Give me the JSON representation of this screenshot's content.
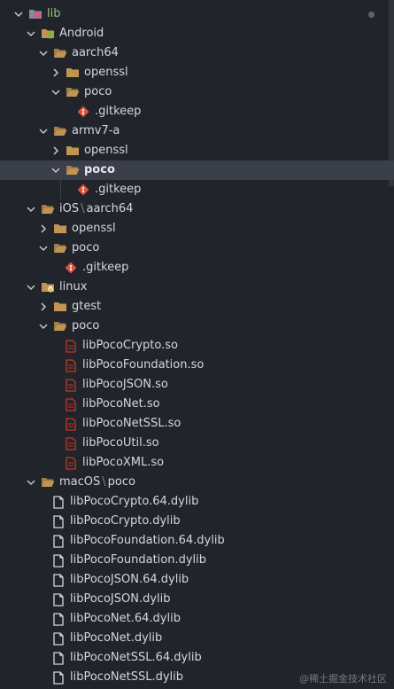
{
  "tree": [
    {
      "label": "lib",
      "type": "folder-special",
      "depth": 0,
      "expanded": true,
      "color": "#98c379",
      "dot": true
    },
    {
      "label": "Android",
      "type": "folder-android",
      "depth": 1,
      "expanded": true
    },
    {
      "label": "aarch64",
      "type": "folder",
      "depth": 2,
      "expanded": true
    },
    {
      "label": "openssl",
      "type": "folder",
      "depth": 3,
      "expanded": false
    },
    {
      "label": "poco",
      "type": "folder",
      "depth": 3,
      "expanded": true
    },
    {
      "label": ".gitkeep",
      "type": "git",
      "depth": 4
    },
    {
      "label": "armv7-a",
      "type": "folder",
      "depth": 2,
      "expanded": true
    },
    {
      "label": "openssl",
      "type": "folder",
      "depth": 3,
      "expanded": false
    },
    {
      "label": "poco",
      "type": "folder",
      "depth": 3,
      "expanded": true,
      "selected": true
    },
    {
      "label": ".gitkeep",
      "type": "git",
      "depth": 4
    },
    {
      "label": "iOS",
      "label2": "aarch64",
      "type": "folder",
      "depth": 1,
      "expanded": true
    },
    {
      "label": "openssl",
      "type": "folder",
      "depth": 2,
      "expanded": false
    },
    {
      "label": "poco",
      "type": "folder",
      "depth": 2,
      "expanded": true
    },
    {
      "label": ".gitkeep",
      "type": "git",
      "depth": 3
    },
    {
      "label": "linux",
      "type": "folder-linux",
      "depth": 1,
      "expanded": true
    },
    {
      "label": "gtest",
      "type": "folder",
      "depth": 2,
      "expanded": false
    },
    {
      "label": "poco",
      "type": "folder",
      "depth": 2,
      "expanded": true
    },
    {
      "label": "libPocoCrypto.so",
      "type": "so",
      "depth": 3
    },
    {
      "label": "libPocoFoundation.so",
      "type": "so",
      "depth": 3
    },
    {
      "label": "libPocoJSON.so",
      "type": "so",
      "depth": 3
    },
    {
      "label": "libPocoNet.so",
      "type": "so",
      "depth": 3
    },
    {
      "label": "libPocoNetSSL.so",
      "type": "so",
      "depth": 3
    },
    {
      "label": "libPocoUtil.so",
      "type": "so",
      "depth": 3
    },
    {
      "label": "libPocoXML.so",
      "type": "so",
      "depth": 3
    },
    {
      "label": "macOS",
      "label2": "poco",
      "type": "folder",
      "depth": 1,
      "expanded": true
    },
    {
      "label": "libPocoCrypto.64.dylib",
      "type": "file",
      "depth": 2
    },
    {
      "label": "libPocoCrypto.dylib",
      "type": "file",
      "depth": 2
    },
    {
      "label": "libPocoFoundation.64.dylib",
      "type": "file",
      "depth": 2
    },
    {
      "label": "libPocoFoundation.dylib",
      "type": "file",
      "depth": 2
    },
    {
      "label": "libPocoJSON.64.dylib",
      "type": "file",
      "depth": 2
    },
    {
      "label": "libPocoJSON.dylib",
      "type": "file",
      "depth": 2
    },
    {
      "label": "libPocoNet.64.dylib",
      "type": "file",
      "depth": 2
    },
    {
      "label": "libPocoNet.dylib",
      "type": "file",
      "depth": 2
    },
    {
      "label": "libPocoNetSSL.64.dylib",
      "type": "file",
      "depth": 2
    },
    {
      "label": "libPocoNetSSL.dylib",
      "type": "file",
      "depth": 2
    }
  ],
  "separator": "\\",
  "watermark": "@稀土掘金技术社区",
  "colors": {
    "background": "#21252b",
    "selected_row": "#3a3f4b",
    "folder": "#c09553",
    "git": "#e0533c",
    "so_file": "#c0392b",
    "text": "#d4d7dd",
    "accent_green": "#98c379"
  }
}
